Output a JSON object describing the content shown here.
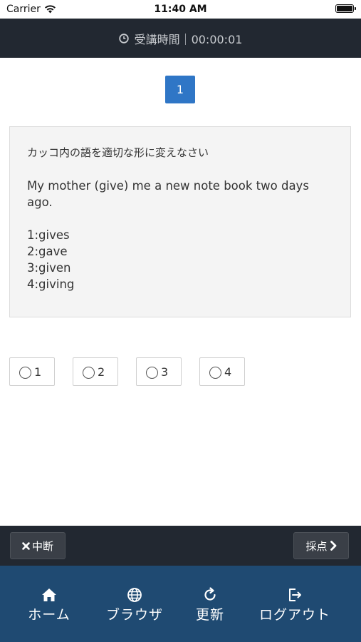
{
  "status_bar": {
    "carrier": "Carrier",
    "time": "11:40 AM"
  },
  "timer": {
    "label": "受講時間｜00:00:01"
  },
  "pagination": {
    "current_page": "1"
  },
  "question": {
    "instruction": "カッコ内の語を適切な形に変えなさい",
    "sentence": "My mother (give) me a new note book two days ago.",
    "options": [
      "1:gives",
      "2:gave",
      "3:given",
      "4:giving"
    ]
  },
  "answers": [
    "1",
    "2",
    "3",
    "4"
  ],
  "actions": {
    "suspend_label": "中断",
    "score_label": "採点"
  },
  "tabs": {
    "home": "ホーム",
    "browser": "ブラウザ",
    "refresh": "更新",
    "logout": "ログアウト"
  },
  "colors": {
    "header_bg": "#222831",
    "page_accent": "#2f76c6",
    "tab_bar_bg": "#1f4a72"
  }
}
